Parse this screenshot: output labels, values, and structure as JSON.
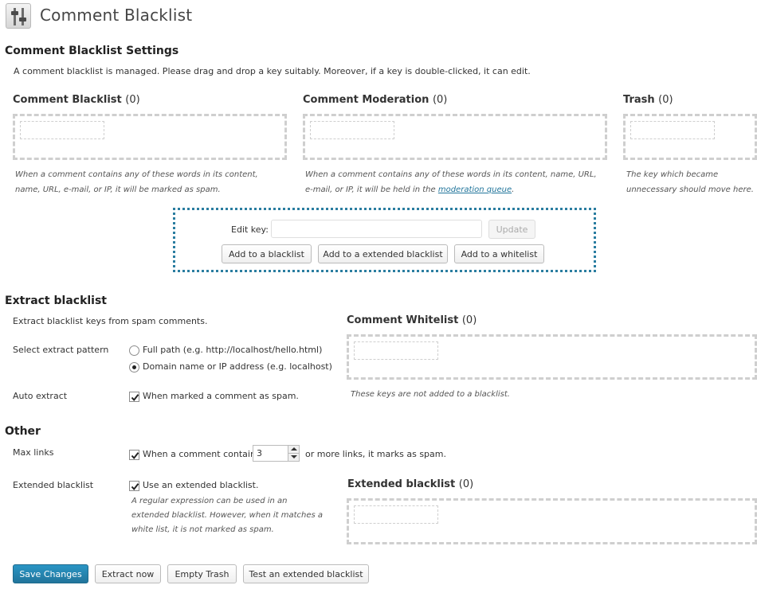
{
  "page": {
    "title": "Comment Blacklist"
  },
  "settings": {
    "heading": "Comment Blacklist Settings",
    "description": "A comment blacklist is managed. Please drag and drop a key suitably. Moreover, if a key is double-clicked, it can edit."
  },
  "lists": {
    "blacklist": {
      "title": "Comment Blacklist",
      "count": "(0)",
      "note_line1": "When a comment contains any of these words in its content,",
      "note_line2": "name, URL, e-mail, or IP, it will be marked as spam."
    },
    "moderation": {
      "title": "Comment Moderation",
      "count": "(0)",
      "note_line1": "When a comment contains any of these words in its content, name, URL,",
      "note_line2_prefix": "e-mail, or IP, it will be held in the ",
      "note_link": "moderation queue",
      "note_line2_suffix": "."
    },
    "trash": {
      "title": "Trash",
      "count": "(0)",
      "note_line1": "The key which became",
      "note_line2": "unnecessary should move here."
    },
    "whitelist": {
      "title": "Comment Whitelist",
      "count": "(0)",
      "note": "These keys are not added to a blacklist."
    },
    "extended": {
      "title": "Extended blacklist",
      "count": "(0)"
    }
  },
  "edit_panel": {
    "label": "Edit key:",
    "value": "",
    "update_label": "Update",
    "add_blacklist_label": "Add to a blacklist",
    "add_extended_label": "Add to a extended blacklist",
    "add_whitelist_label": "Add to a whitelist"
  },
  "extract": {
    "heading": "Extract blacklist",
    "description": "Extract blacklist keys from spam comments.",
    "pattern_label": "Select extract pattern",
    "option_full_path": "Full path (e.g. http://localhost/hello.html)",
    "option_domain": "Domain name or IP address (e.g. localhost)",
    "selected_option": "domain",
    "auto_label": "Auto extract",
    "auto_checkbox_label": "When marked a comment as spam.",
    "auto_checked": true
  },
  "other": {
    "heading": "Other",
    "max_links_label": "Max links",
    "max_links_prefix": "When a comment contains",
    "max_links_value": "3",
    "max_links_suffix": "or more links, it marks as spam.",
    "max_links_checked": true,
    "extended_label": "Extended blacklist",
    "extended_checkbox_label": "Use an extended blacklist.",
    "extended_checked": true,
    "extended_note_line1": "A regular expression can be used in an",
    "extended_note_line2": "extended blacklist. However, when it matches a",
    "extended_note_line3": "white list, it is not marked as spam."
  },
  "footer": {
    "save_label": "Save Changes",
    "extract_label": "Extract now",
    "empty_trash_label": "Empty Trash",
    "test_label": "Test an extended blacklist"
  },
  "colors": {
    "primary": "#21759b",
    "drop_border": "#cfcfcf",
    "edit_panel_border": "#2a7da0"
  },
  "icons": {
    "page_icon": "settings-sliders-icon",
    "check": "checkmark-icon"
  }
}
